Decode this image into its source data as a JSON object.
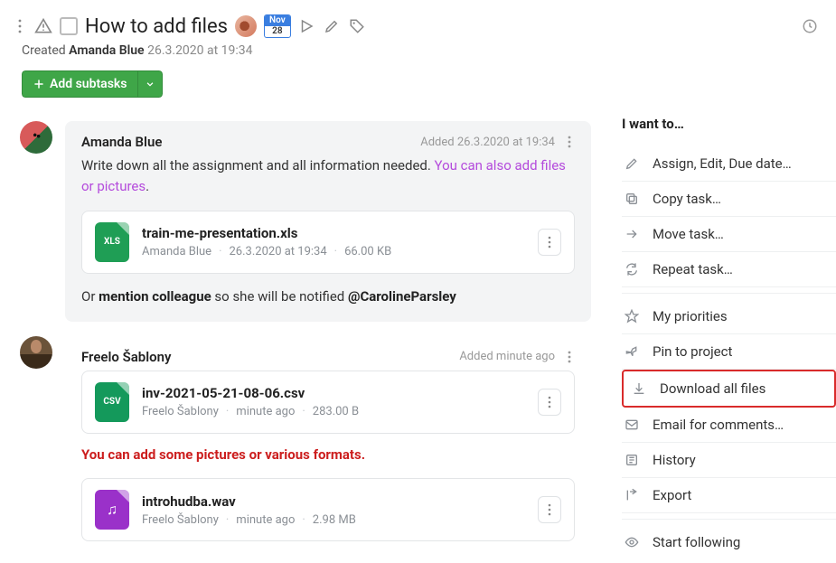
{
  "header": {
    "title": "How to add files",
    "date_badge": {
      "month": "Nov",
      "day": "28"
    },
    "created_label": "Created",
    "created_by": "Amanda Blue",
    "created_at": "26.3.2020 at 19:34"
  },
  "buttons": {
    "add_subtasks": "Add subtasks"
  },
  "comments": [
    {
      "author": "Amanda Blue",
      "added_label": "Added 26.3.2020 at 19:34",
      "body_plain": "Write down all the assignment and all information needed. ",
      "body_link": "You can also add files or pictures",
      "body_after": ".",
      "body2_pre": "Or ",
      "body2_strong": "mention colleague",
      "body2_mid": " so she will be notified ",
      "body2_mention": "@CarolineParsley",
      "attachments": [
        {
          "type": "XLS",
          "name": "train-me-presentation.xls",
          "uploader": "Amanda Blue",
          "time": "26.3.2020 at 19:34",
          "size": "66.00 KB"
        }
      ]
    },
    {
      "author": "Freelo Šablony",
      "added_label": "Added minute ago",
      "note": "You can add some pictures or various formats.",
      "attachments": [
        {
          "type": "CSV",
          "name": "inv-2021-05-21-08-06.csv",
          "uploader": "Freelo Šablony",
          "time": "minute ago",
          "size": "283.00 B"
        },
        {
          "type": "WAV",
          "glyph": "♫",
          "name": "introhudba.wav",
          "uploader": "Freelo Šablony",
          "time": "minute ago",
          "size": "2.98 MB"
        }
      ]
    }
  ],
  "side": {
    "heading": "I want to…",
    "items": {
      "assign": "Assign, Edit, Due date…",
      "copy": "Copy task…",
      "move": "Move task…",
      "repeat": "Repeat task…",
      "priorities": "My priorities",
      "pin": "Pin to project",
      "download": "Download all files",
      "email": "Email for comments…",
      "history": "History",
      "export": "Export",
      "follow": "Start following"
    }
  }
}
